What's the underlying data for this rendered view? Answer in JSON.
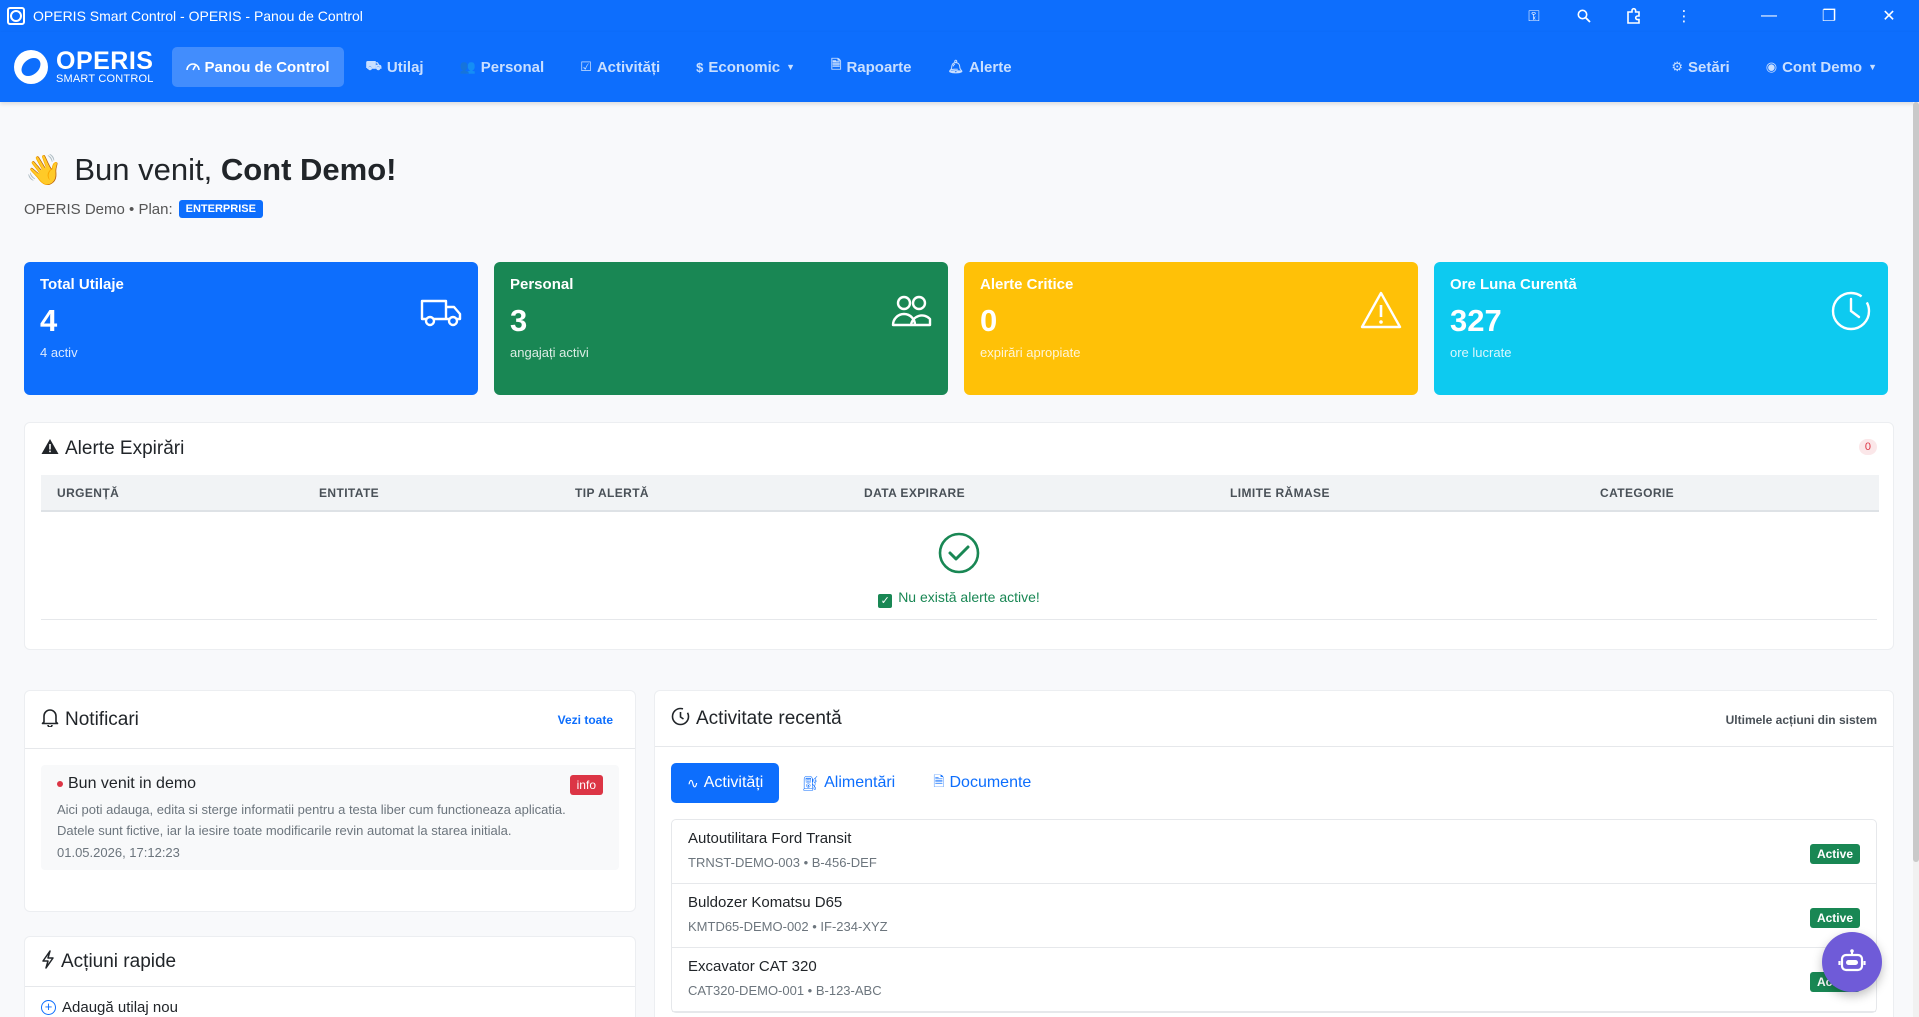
{
  "window": {
    "title": "OPERIS Smart Control - OPERIS - Panou de Control",
    "toolbar_icons": [
      "key-icon",
      "zoom-icon",
      "extensions-icon",
      "more-icon"
    ],
    "controls": [
      "minimize",
      "restore",
      "close"
    ]
  },
  "navbar": {
    "brand_name": "OPERIS",
    "brand_sub": "SMART CONTROL",
    "items": [
      {
        "label": "Panou de Control",
        "icon": "dashboard-icon",
        "active": true
      },
      {
        "label": "Utilaj",
        "icon": "truck-icon"
      },
      {
        "label": "Personal",
        "icon": "people-icon"
      },
      {
        "label": "Activități",
        "icon": "calendar-check-icon"
      },
      {
        "label": "Economic",
        "icon": "dollar-icon",
        "dropdown": true
      },
      {
        "label": "Rapoarte",
        "icon": "document-icon"
      },
      {
        "label": "Alerte",
        "icon": "bell-icon"
      }
    ],
    "settings_label": "Setări",
    "account_label": "Cont Demo"
  },
  "greeting": {
    "prefix": "Bun venit, ",
    "name": "Cont Demo!",
    "company": "OPERIS Demo • Plan:",
    "plan": "ENTERPRISE"
  },
  "stats": [
    {
      "label": "Total Utilaje",
      "value": "4",
      "sub": "4 activ",
      "color": "#0d6efd",
      "icon": "truck-icon"
    },
    {
      "label": "Personal",
      "value": "3",
      "sub": "angajați activi",
      "color": "#198754",
      "icon": "people-icon"
    },
    {
      "label": "Alerte Critice",
      "value": "0",
      "sub": "expirări apropiate",
      "color": "#ffc107",
      "icon": "warning-icon"
    },
    {
      "label": "Ore Luna Curentă",
      "value": "327",
      "sub": "ore lucrate",
      "color": "#0dcaf0",
      "icon": "clock-icon"
    }
  ],
  "expiry_alerts": {
    "title": "Alerte Expirări",
    "count": "0",
    "columns": [
      "URGENȚĂ",
      "ENTITATE",
      "TIP ALERTĂ",
      "DATA EXPIRARE",
      "LIMITE RĂMASE",
      "CATEGORIE"
    ],
    "empty_text": "Nu există alerte active!"
  },
  "notifications": {
    "title": "Notificari",
    "view_all": "Vezi toate",
    "items": [
      {
        "title": "Bun venit in demo",
        "badge": "info",
        "body": "Aici poti adauga, edita si sterge informatii pentru a testa liber cum functioneaza aplicatia. Datele sunt fictive, iar la iesire toate modificarile revin automat la starea initiala.",
        "date": "01.05.2026, 17:12:23"
      }
    ]
  },
  "quick_actions": {
    "title": "Acțiuni rapide",
    "items": [
      "Adaugă utilaj nou"
    ]
  },
  "recent_activity": {
    "title": "Activitate recentă",
    "subtitle": "Ultimele acțiuni din sistem",
    "tabs": [
      "Activități",
      "Alimentări",
      "Documente"
    ],
    "items": [
      {
        "name": "Autoutilitara Ford Transit",
        "meta": "TRNST-DEMO-003 • B-456-DEF",
        "status": "Active"
      },
      {
        "name": "Buldozer Komatsu D65",
        "meta": "KMTD65-DEMO-002 • IF-234-XYZ",
        "status": "Active"
      },
      {
        "name": "Excavator CAT 320",
        "meta": "CAT320-DEMO-001 • B-123-ABC",
        "status": "Active"
      }
    ]
  }
}
